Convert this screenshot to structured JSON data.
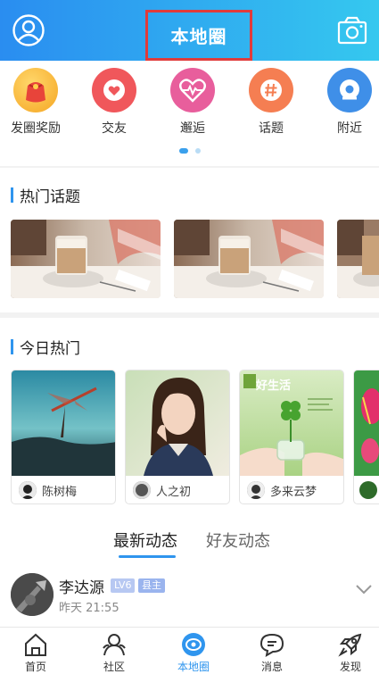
{
  "header": {
    "title": "本地圈",
    "left_icon": "user-avatar-icon",
    "right_icon": "camera-icon",
    "gradient": [
      "#2a8df0",
      "#35c8ef"
    ],
    "highlight_color": "#e03b3b"
  },
  "categories": [
    {
      "label": "发圈奖励",
      "icon": "red-envelope-icon",
      "color": "#f8b24a"
    },
    {
      "label": "交友",
      "icon": "heart-icon",
      "color": "#f0575b"
    },
    {
      "label": "邂逅",
      "icon": "heartbeat-icon",
      "color": "#e85e9c"
    },
    {
      "label": "话题",
      "icon": "hashtag-icon",
      "color": "#f57e52"
    },
    {
      "label": "附近",
      "icon": "location-icon",
      "color": "#3f8fe8"
    }
  ],
  "pager": {
    "count": 2,
    "active": 0
  },
  "hot_topics": {
    "title": "热门话题",
    "cards": [
      {
        "image": "coffee-table-photo"
      },
      {
        "image": "coffee-table-photo"
      },
      {
        "image": "coffee-table-photo"
      }
    ]
  },
  "today_hot": {
    "title": "今日热门",
    "cards": [
      {
        "image": "dragonfly-photo",
        "name": "陈树梅"
      },
      {
        "image": "girl-portrait-photo",
        "name": "人之初"
      },
      {
        "image": "clover-jar-photo",
        "name": "多来云梦",
        "overlay_text": "好生活"
      },
      {
        "image": "flower-photo",
        "name": ""
      }
    ]
  },
  "feed_tabs": [
    {
      "label": "最新动态",
      "active": true
    },
    {
      "label": "好友动态",
      "active": false
    }
  ],
  "post": {
    "author": "李达源",
    "level": "LV6",
    "role": "县主",
    "time": "昨天 21:55"
  },
  "tabbar": [
    {
      "label": "首页",
      "icon": "home-icon",
      "active": false
    },
    {
      "label": "社区",
      "icon": "community-icon",
      "active": false
    },
    {
      "label": "本地圈",
      "icon": "local-circle-icon",
      "active": true
    },
    {
      "label": "消息",
      "icon": "message-icon",
      "active": false
    },
    {
      "label": "发现",
      "icon": "rocket-icon",
      "active": false
    }
  ],
  "colors": {
    "accent": "#2f95ee",
    "divider": "#f2f2f2"
  }
}
